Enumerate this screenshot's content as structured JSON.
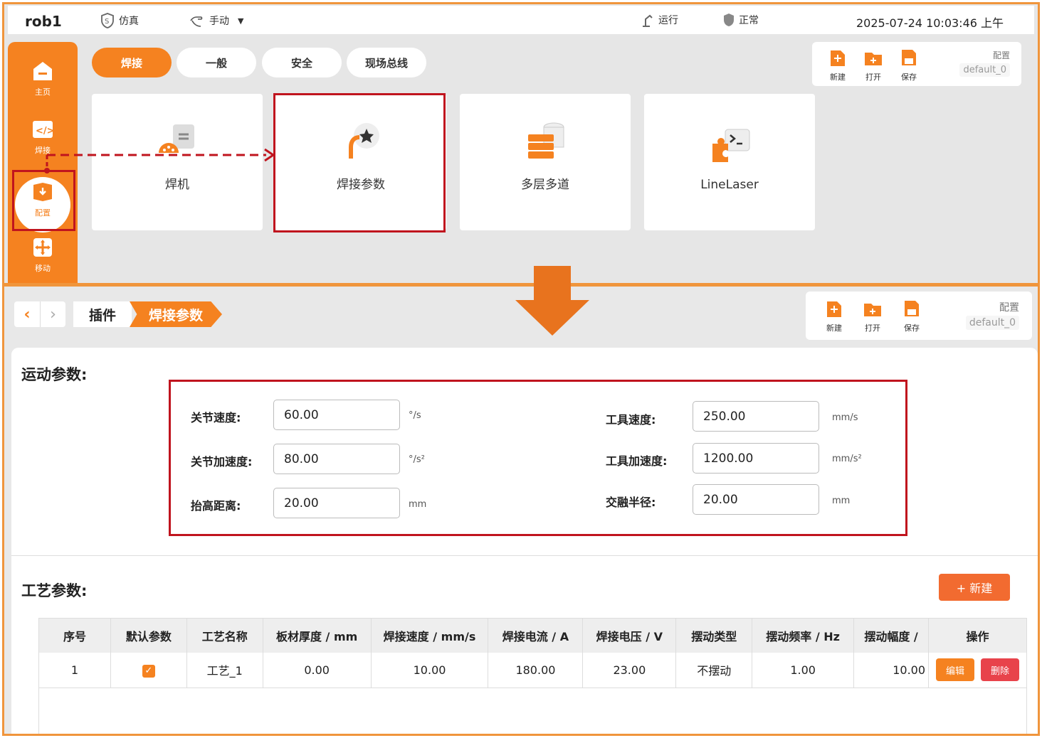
{
  "header": {
    "robot": "rob1",
    "sim_label": "仿真",
    "manual_label": "手动",
    "run_label": "运行",
    "normal_label": "正常",
    "datetime": "2025-07-24 10:03:46 上午"
  },
  "sidebar": {
    "home": "主页",
    "weld": "焊接",
    "config": "配置",
    "move": "移动"
  },
  "tabs": [
    "焊接",
    "一般",
    "安全",
    "现场总线"
  ],
  "cards": [
    "焊机",
    "焊接参数",
    "多层多道",
    "LineLaser"
  ],
  "config_panel": {
    "new": "新建",
    "open": "打开",
    "save": "保存",
    "label": "配置",
    "value": "default_0"
  },
  "breadcrumb": {
    "plugin": "插件",
    "current": "焊接参数"
  },
  "motion": {
    "title": "运动参数:",
    "joint_speed": {
      "label": "关节速度:",
      "value": "60.00",
      "unit": "°/s"
    },
    "joint_accel": {
      "label": "关节加速度:",
      "value": "80.00",
      "unit": "°/s²"
    },
    "lift": {
      "label": "抬高距离:",
      "value": "20.00",
      "unit": "mm"
    },
    "tool_speed": {
      "label": "工具速度:",
      "value": "250.00",
      "unit": "mm/s"
    },
    "tool_accel": {
      "label": "工具加速度:",
      "value": "1200.00",
      "unit": "mm/s²"
    },
    "blend": {
      "label": "交融半径:",
      "value": "20.00",
      "unit": "mm"
    }
  },
  "process": {
    "title": "工艺参数:",
    "new_button": "+ 新建",
    "columns": [
      "序号",
      "默认参数",
      "工艺名称",
      "板材厚度 / mm",
      "焊接速度 / mm/s",
      "焊接电流 / A",
      "焊接电压 / V",
      "摆动类型",
      "摆动频率 / Hz",
      "摆动幅度 /",
      "操作"
    ],
    "rows": [
      {
        "index": "1",
        "default": true,
        "name": "工艺_1",
        "thickness": "0.00",
        "speed": "10.00",
        "current": "180.00",
        "voltage": "23.00",
        "weave_type": "不摆动",
        "weave_freq": "1.00",
        "weave_amp": "10.00",
        "edit": "编辑",
        "delete": "删除"
      }
    ]
  },
  "colors": {
    "accent": "#f58220",
    "annotation_red": "#c0141e",
    "danger": "#e8434b"
  }
}
